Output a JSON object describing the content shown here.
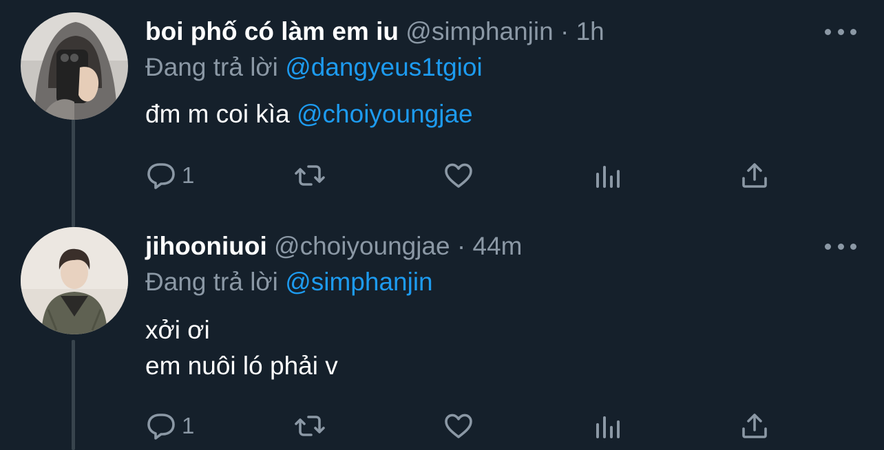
{
  "tweets": [
    {
      "display_name": "boi phố có làm em iu",
      "handle": "@simphanjin",
      "separator": "·",
      "time": "1h",
      "reply_prefix": "Đang trả lời",
      "reply_to": "@dangyeus1tgioi",
      "body_text": "đm m coi kìa",
      "body_mention": "@choiyoungjae",
      "body_line2": "",
      "reply_count": "1"
    },
    {
      "display_name": "jihooniuoi",
      "handle": "@choiyoungjae",
      "separator": "·",
      "time": "44m",
      "reply_prefix": "Đang trả lời",
      "reply_to": "@simphanjin",
      "body_text": "xởi ơi",
      "body_mention": "",
      "body_line2": "em nuôi ló phải v",
      "reply_count": "1"
    }
  ],
  "icons": {
    "reply": "reply-icon",
    "retweet": "retweet-icon",
    "like": "like-icon",
    "views": "views-icon",
    "share": "share-icon",
    "more": "more-icon"
  },
  "colors": {
    "background": "#15202b",
    "text": "#ffffff",
    "secondary": "#8b98a5",
    "mention": "#1d9bf0",
    "thread_line": "#38444d"
  }
}
